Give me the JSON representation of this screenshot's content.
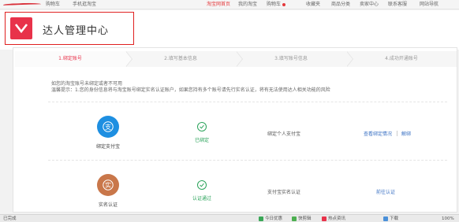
{
  "topbar": {
    "left_item_1": "购物车",
    "left_item_2": "手机逛淘宝",
    "items": [
      "淘宝网首页",
      "我的淘宝",
      "购物车",
      "收藏夹",
      "商品分类",
      "卖家中心",
      "联系客服",
      "网站导航"
    ]
  },
  "header": {
    "title": "达人管理中心"
  },
  "steps": [
    {
      "label": "1.绑定账号",
      "active": true
    },
    {
      "label": "2.填写基本信息",
      "active": false
    },
    {
      "label": "3.填写账号信息",
      "active": false
    },
    {
      "label": "4.成功开通账号",
      "active": false
    }
  ],
  "notice": {
    "line1": "如您的淘宝账号未绑定或者不可用",
    "line2": "温馨提示：1.您的身份信息将与淘宝账号绑定实名认证账户，如果您持有多个账号请先行实名认证，将有无法使用达人相关功能的风险"
  },
  "rows": [
    {
      "icon_name": "alipay-icon",
      "icon_glyph": "支",
      "label": "绑定支付宝",
      "status": "已绑定",
      "description": "绑定个人支付宝",
      "link_primary": "查看绑定情况",
      "link_secondary": "解绑"
    },
    {
      "icon_name": "real-name-icon",
      "icon_glyph": "实",
      "label": "实名认证",
      "status": "认证通过",
      "description": "支付宝实名认证",
      "link_primary": "前往认证"
    }
  ],
  "statusbar": {
    "left": "已完成",
    "items": [
      "今日优惠",
      "快剪辑",
      "热点资讯",
      "下载",
      "100%"
    ]
  },
  "colors": {
    "brand": "#e8324a",
    "alipay": "#1e8fe1",
    "real_name": "#c9774a",
    "success": "#2aa35a",
    "link": "#3b72c4"
  }
}
